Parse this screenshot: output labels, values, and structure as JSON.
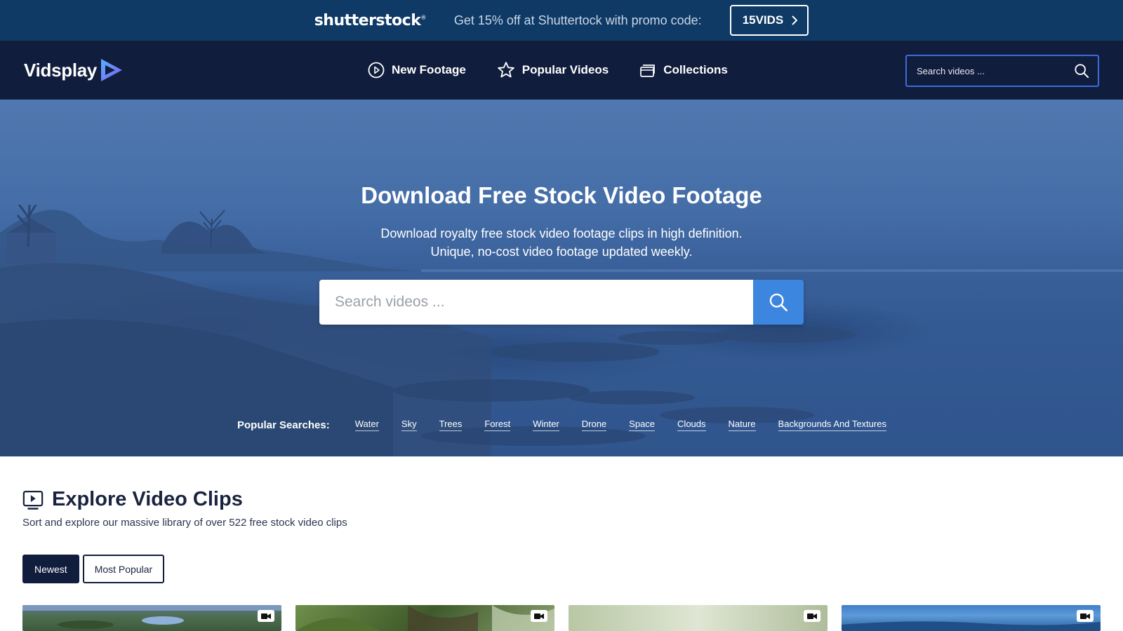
{
  "promo": {
    "logo": "shutterstock",
    "text": "Get 15% off at Shuttertock with promo code:",
    "code": "15VIDS"
  },
  "nav": {
    "brand": "Vidsplay",
    "links": [
      {
        "label": "New Footage",
        "icon": "play-circle-icon"
      },
      {
        "label": "Popular Videos",
        "icon": "star-icon"
      },
      {
        "label": "Collections",
        "icon": "collections-icon"
      }
    ],
    "search_placeholder": "Search videos ..."
  },
  "hero": {
    "title": "Download Free Stock Video Footage",
    "subtitle_line1": "Download royalty free stock video footage clips in high definition.",
    "subtitle_line2": "Unique, no-cost video footage updated weekly.",
    "search_placeholder": "Search videos ...",
    "popular_label": "Popular Searches:",
    "tags": [
      "Water",
      "Sky",
      "Trees",
      "Forest",
      "Winter",
      "Drone",
      "Space",
      "Clouds",
      "Nature",
      "Backgrounds And Textures"
    ]
  },
  "explore": {
    "title": "Explore Video Clips",
    "subtitle": "Sort and explore our massive library of over 522 free stock video clips",
    "sort_newest": "Newest",
    "sort_popular": "Most Popular"
  },
  "colors": {
    "promo_bg": "#0f3a66",
    "nav_bg": "#111d3c",
    "accent": "#3d86e0"
  }
}
